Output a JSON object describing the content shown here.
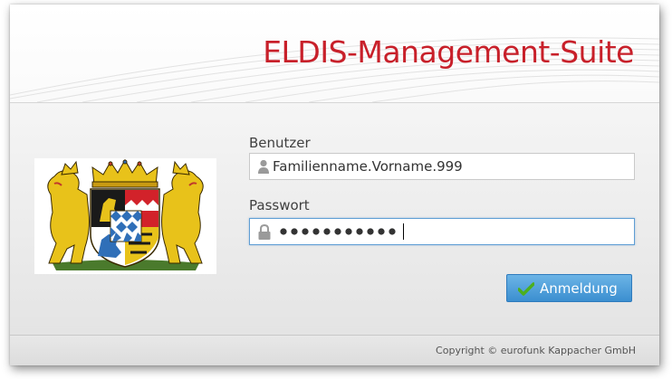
{
  "header": {
    "title": "ELDIS-Management-Suite"
  },
  "login": {
    "user_label": "Benutzer",
    "user_value": "Familienname.Vorname.999",
    "password_label": "Passwort",
    "password_length": 11,
    "submit_label": "Anmeldung"
  },
  "footer": {
    "copyright": "Copyright © eurofunk Kappacher GmbH"
  },
  "icons": {
    "user": "user-icon",
    "lock": "lock-icon",
    "check": "checkmark-icon",
    "crest": "bavarian-coat-of-arms"
  },
  "colors": {
    "title": "#c8202a",
    "button": "#3b8fd0",
    "focus_border": "#5f9ed4",
    "check": "#4caf1e"
  }
}
